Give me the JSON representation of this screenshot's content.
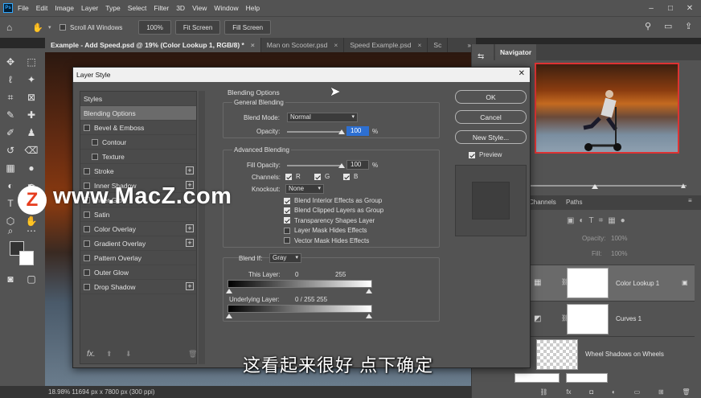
{
  "menubar": {
    "logo": "Ps",
    "items": [
      "File",
      "Edit",
      "Image",
      "Layer",
      "Type",
      "Select",
      "Filter",
      "3D",
      "View",
      "Window",
      "Help"
    ]
  },
  "options": {
    "scroll_all_windows": "Scroll All Windows",
    "zoom_value": "100%",
    "fit_screen_1": "Fit Screen",
    "fit_screen_2": "Fill Screen"
  },
  "tabs": [
    {
      "label": "Example - Add Speed.psd @ 19% (Color Lookup 1, RGB/8) *"
    },
    {
      "label": "Man on Scooter.psd"
    },
    {
      "label": "Speed Example.psd"
    },
    {
      "label": "Sc"
    }
  ],
  "status": {
    "text": "18.98%  11694 px x 7800 px (300 ppi)"
  },
  "navigator": {
    "title": "Navigator"
  },
  "layers_panel": {
    "tabs": [
      "Channels",
      "Paths"
    ],
    "opacity_label": "Opacity:",
    "opacity_value": "100%",
    "fill_label": "Fill:",
    "fill_value": "100%",
    "layers": [
      "Color Lookup 1",
      "Curves 1",
      "Wheel Shadows on Wheels"
    ]
  },
  "dialog": {
    "title": "Layer Style",
    "styles_header": "Styles",
    "items": [
      {
        "label": "Blending Options",
        "checkbox": false,
        "plus": false,
        "selected": true
      },
      {
        "label": "Bevel & Emboss",
        "checkbox": true,
        "plus": false,
        "selected": false
      },
      {
        "label": "Contour",
        "checkbox": true,
        "plus": false,
        "selected": false,
        "indent": true
      },
      {
        "label": "Texture",
        "checkbox": true,
        "plus": false,
        "selected": false,
        "indent": true
      },
      {
        "label": "Stroke",
        "checkbox": true,
        "plus": true,
        "selected": false
      },
      {
        "label": "Inner Shadow",
        "checkbox": true,
        "plus": true,
        "selected": false
      },
      {
        "label": "Inner Glow",
        "checkbox": true,
        "plus": false,
        "selected": false
      },
      {
        "label": "Satin",
        "checkbox": true,
        "plus": false,
        "selected": false
      },
      {
        "label": "Color Overlay",
        "checkbox": true,
        "plus": true,
        "selected": false
      },
      {
        "label": "Gradient Overlay",
        "checkbox": true,
        "plus": true,
        "selected": false
      },
      {
        "label": "Pattern Overlay",
        "checkbox": true,
        "plus": false,
        "selected": false
      },
      {
        "label": "Outer Glow",
        "checkbox": true,
        "plus": false,
        "selected": false
      },
      {
        "label": "Drop Shadow",
        "checkbox": true,
        "plus": true,
        "selected": false
      }
    ],
    "fx_label": "fx.",
    "blending_options": "Blending Options",
    "general_blending": "General Blending",
    "blend_mode_label": "Blend Mode:",
    "blend_mode_value": "Normal",
    "opacity_label": "Opacity:",
    "opacity_value": "100",
    "opacity_percent": "%",
    "opacity_level": 1.0,
    "advanced_blending": "Advanced Blending",
    "fill_opacity_label": "Fill Opacity:",
    "fill_opacity_value": "100",
    "fill_percent": "%",
    "fill_level": 1.0,
    "channels_label": "Channels:",
    "channel_r": "R",
    "channel_g": "G",
    "channel_b": "B",
    "knockout_label": "Knockout:",
    "knockout_value": "None",
    "adv_checks": [
      {
        "label": "Blend Interior Effects as Group",
        "checked": true
      },
      {
        "label": "Blend Clipped Layers as Group",
        "checked": true
      },
      {
        "label": "Transparency Shapes Layer",
        "checked": true
      },
      {
        "label": "Layer Mask Hides Effects",
        "checked": false
      },
      {
        "label": "Vector Mask Hides Effects",
        "checked": false
      }
    ],
    "blend_if_label": "Blend If:",
    "blend_if_value": "Gray",
    "this_layer_label": "This Layer:",
    "this_layer_low": "0",
    "this_layer_high": "255",
    "underlying_label": "Underlying Layer:",
    "underlying_values": "0  /  255  255",
    "ok": "OK",
    "cancel": "Cancel",
    "new_style": "New Style...",
    "preview": "Preview"
  },
  "watermark": {
    "text": "www.MacZ.com",
    "logo": "Z"
  },
  "subtitle": "这看起来很好 点下确定"
}
